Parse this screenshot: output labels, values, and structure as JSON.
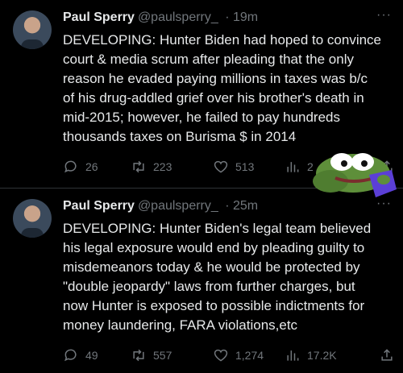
{
  "tweets": [
    {
      "name": "Paul Sperry",
      "handle": "@paulsperry_",
      "time": "· 19m",
      "text": "DEVELOPING: Hunter Biden had hoped to convince\ncourt & media scrum after pleading that the only\nreason he evaded paying millions in taxes was b/c\nof his drug-addled grief over his brother's death in\nmid-2015; however, he failed to pay hundreds\nthousands taxes on Burisma $ in 2014",
      "replies": "26",
      "retweets": "223",
      "likes": "513",
      "views": "2"
    },
    {
      "name": "Paul Sperry",
      "handle": "@paulsperry_",
      "time": "· 25m",
      "text": "DEVELOPING: Hunter Biden's legal team believed\nhis legal exposure would end by pleading guilty to\nmisdemeanors today & he would be protected by\n\"double jeopardy\" laws from further charges, but\nnow Hunter is exposed to possible indictments for\nmoney laundering, FARA violations,etc",
      "replies": "49",
      "retweets": "557",
      "likes": "1,274",
      "views": "17.2K"
    }
  ],
  "more_glyph": "···",
  "colors": {
    "background": "#000000",
    "text": "#e7e9ea",
    "secondary": "#71767b"
  },
  "icons": [
    "reply-icon",
    "retweet-icon",
    "like-icon",
    "views-icon",
    "share-icon",
    "pepe-sticker"
  ]
}
